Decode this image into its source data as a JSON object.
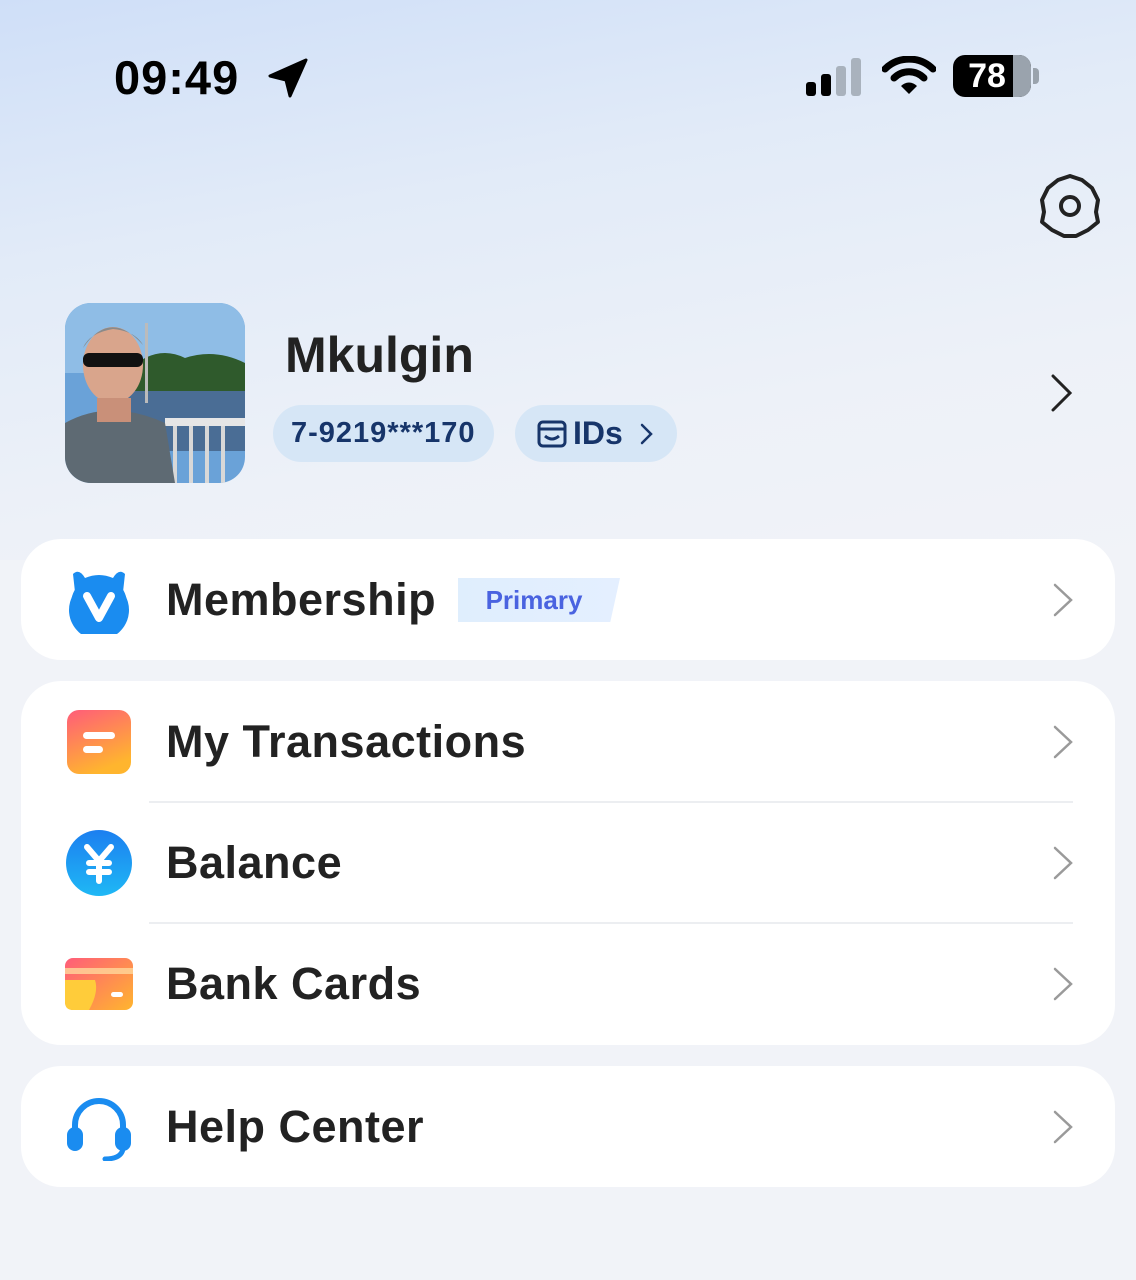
{
  "status_bar": {
    "time": "09:49",
    "battery": "78"
  },
  "profile": {
    "username": "Mkulgin",
    "phone": "7-9219***170",
    "ids_label": "IDs"
  },
  "menu": {
    "membership": {
      "label": "Membership",
      "badge": "Primary"
    },
    "transactions": {
      "label": "My Transactions"
    },
    "balance": {
      "label": "Balance"
    },
    "bank_cards": {
      "label": "Bank Cards"
    },
    "help_center": {
      "label": "Help Center"
    }
  },
  "colors": {
    "accent_text": "#17356a",
    "chip_bg": "#d6e6f6",
    "badge_text": "#4a63e0",
    "membership_blue": "#1a8cf0",
    "balance_blue": "#1f8cf2"
  },
  "icons": [
    "location-arrow-icon",
    "signal-icon",
    "wifi-icon",
    "battery-icon",
    "gear-icon",
    "id-card-icon",
    "chevron-right-icon",
    "membership-v-icon",
    "transactions-icon",
    "yuan-icon",
    "bank-card-icon",
    "headset-icon"
  ]
}
